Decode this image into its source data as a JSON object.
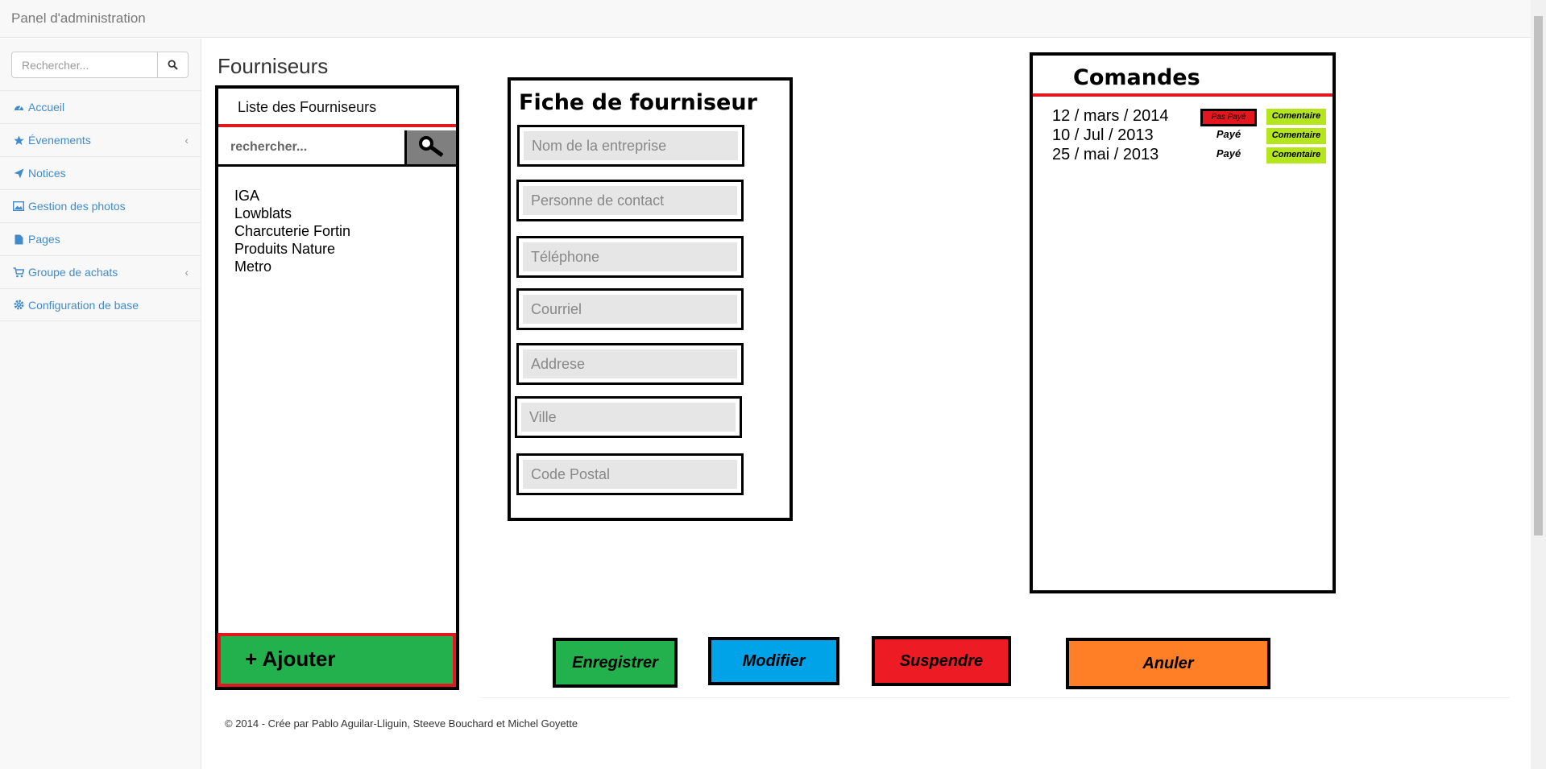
{
  "navbar": {
    "brand": "Panel d'administration"
  },
  "sidebar": {
    "search_placeholder": "Rechercher...",
    "items": [
      {
        "label": "Accueil",
        "icon": "dashboard-icon",
        "has_submenu": false
      },
      {
        "label": "Évenements",
        "icon": "star-icon",
        "has_submenu": true
      },
      {
        "label": "Notices",
        "icon": "send-icon",
        "has_submenu": false
      },
      {
        "label": "Gestion des photos",
        "icon": "picture-icon",
        "has_submenu": false
      },
      {
        "label": "Pages",
        "icon": "file-icon",
        "has_submenu": false
      },
      {
        "label": "Groupe de achats",
        "icon": "cart-icon",
        "has_submenu": true
      },
      {
        "label": "Configuration de base",
        "icon": "gear-icon",
        "has_submenu": false
      }
    ]
  },
  "page": {
    "title": "Fourniseurs"
  },
  "supplier_list": {
    "header": "Liste des Fourniseurs",
    "search_placeholder": "rechercher...",
    "items": [
      "IGA",
      "Lowblats",
      "Charcuterie Fortin",
      "Produits Nature",
      "Metro"
    ],
    "add_button": "+ Ajouter"
  },
  "supplier_form": {
    "title": "Fiche de fourniseur",
    "fields": [
      {
        "placeholder": "Nom de la entreprise"
      },
      {
        "placeholder": "Personne de contact"
      },
      {
        "placeholder": "Téléphone"
      },
      {
        "placeholder": "Courriel"
      },
      {
        "placeholder": "Addrese"
      },
      {
        "placeholder": "Ville"
      },
      {
        "placeholder": "Code Postal"
      }
    ]
  },
  "orders": {
    "title": "Comandes",
    "rows": [
      {
        "date": "12 / mars / 2014",
        "status": "Pas Payé",
        "paid": false,
        "comment": "Comentaire"
      },
      {
        "date": "10 / Jul / 2013",
        "status": "Payé",
        "paid": true,
        "comment": "Comentaire"
      },
      {
        "date": "25 / mai / 2013",
        "status": "Payé",
        "paid": true,
        "comment": "Comentaire"
      }
    ]
  },
  "actions": {
    "save": "Enregistrer",
    "edit": "Modifier",
    "suspend": "Suspendre",
    "cancel": "Anuler"
  },
  "colors": {
    "link": "#428bca",
    "green": "#22b14c",
    "blue": "#00a2e8",
    "red": "#ed1c24",
    "orange": "#ff7f27",
    "lime": "#b5e61d"
  },
  "footer": {
    "text": "© 2014 - Crée par Pablo Aguilar-Lliguin, Steeve Bouchard et Michel Goyette"
  }
}
